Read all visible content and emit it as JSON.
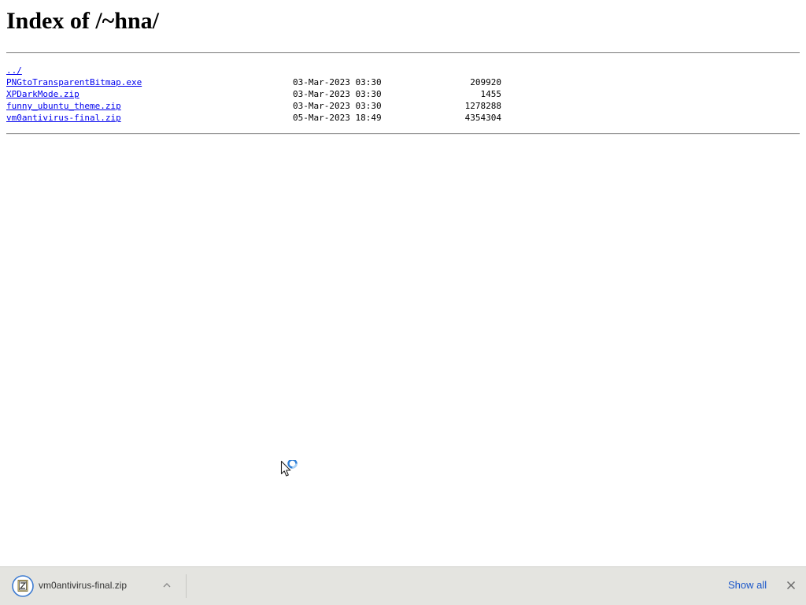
{
  "page": {
    "heading": "Index of /~hna/"
  },
  "listing": {
    "parent_link": "../",
    "files": [
      {
        "name": "PNGtoTransparentBitmap.exe",
        "modified": "03-Mar-2023 03:30",
        "size": "209920"
      },
      {
        "name": "XPDarkMode.zip",
        "modified": "03-Mar-2023 03:30",
        "size": "1455"
      },
      {
        "name": "funny_ubuntu_theme.zip",
        "modified": "03-Mar-2023 03:30",
        "size": "1278288"
      },
      {
        "name": "vm0antivirus-final.zip",
        "modified": "05-Mar-2023 18:49",
        "size": "4354304"
      }
    ]
  },
  "download_shelf": {
    "item_filename": "vm0antivirus-final.zip",
    "item_icon": "zip-file-icon",
    "show_all_label": "Show all",
    "close_icon": "close-icon"
  },
  "colors": {
    "link": "#0000ee",
    "shelf_background": "#e4e4e0",
    "show_all_link": "#1a56c9"
  }
}
